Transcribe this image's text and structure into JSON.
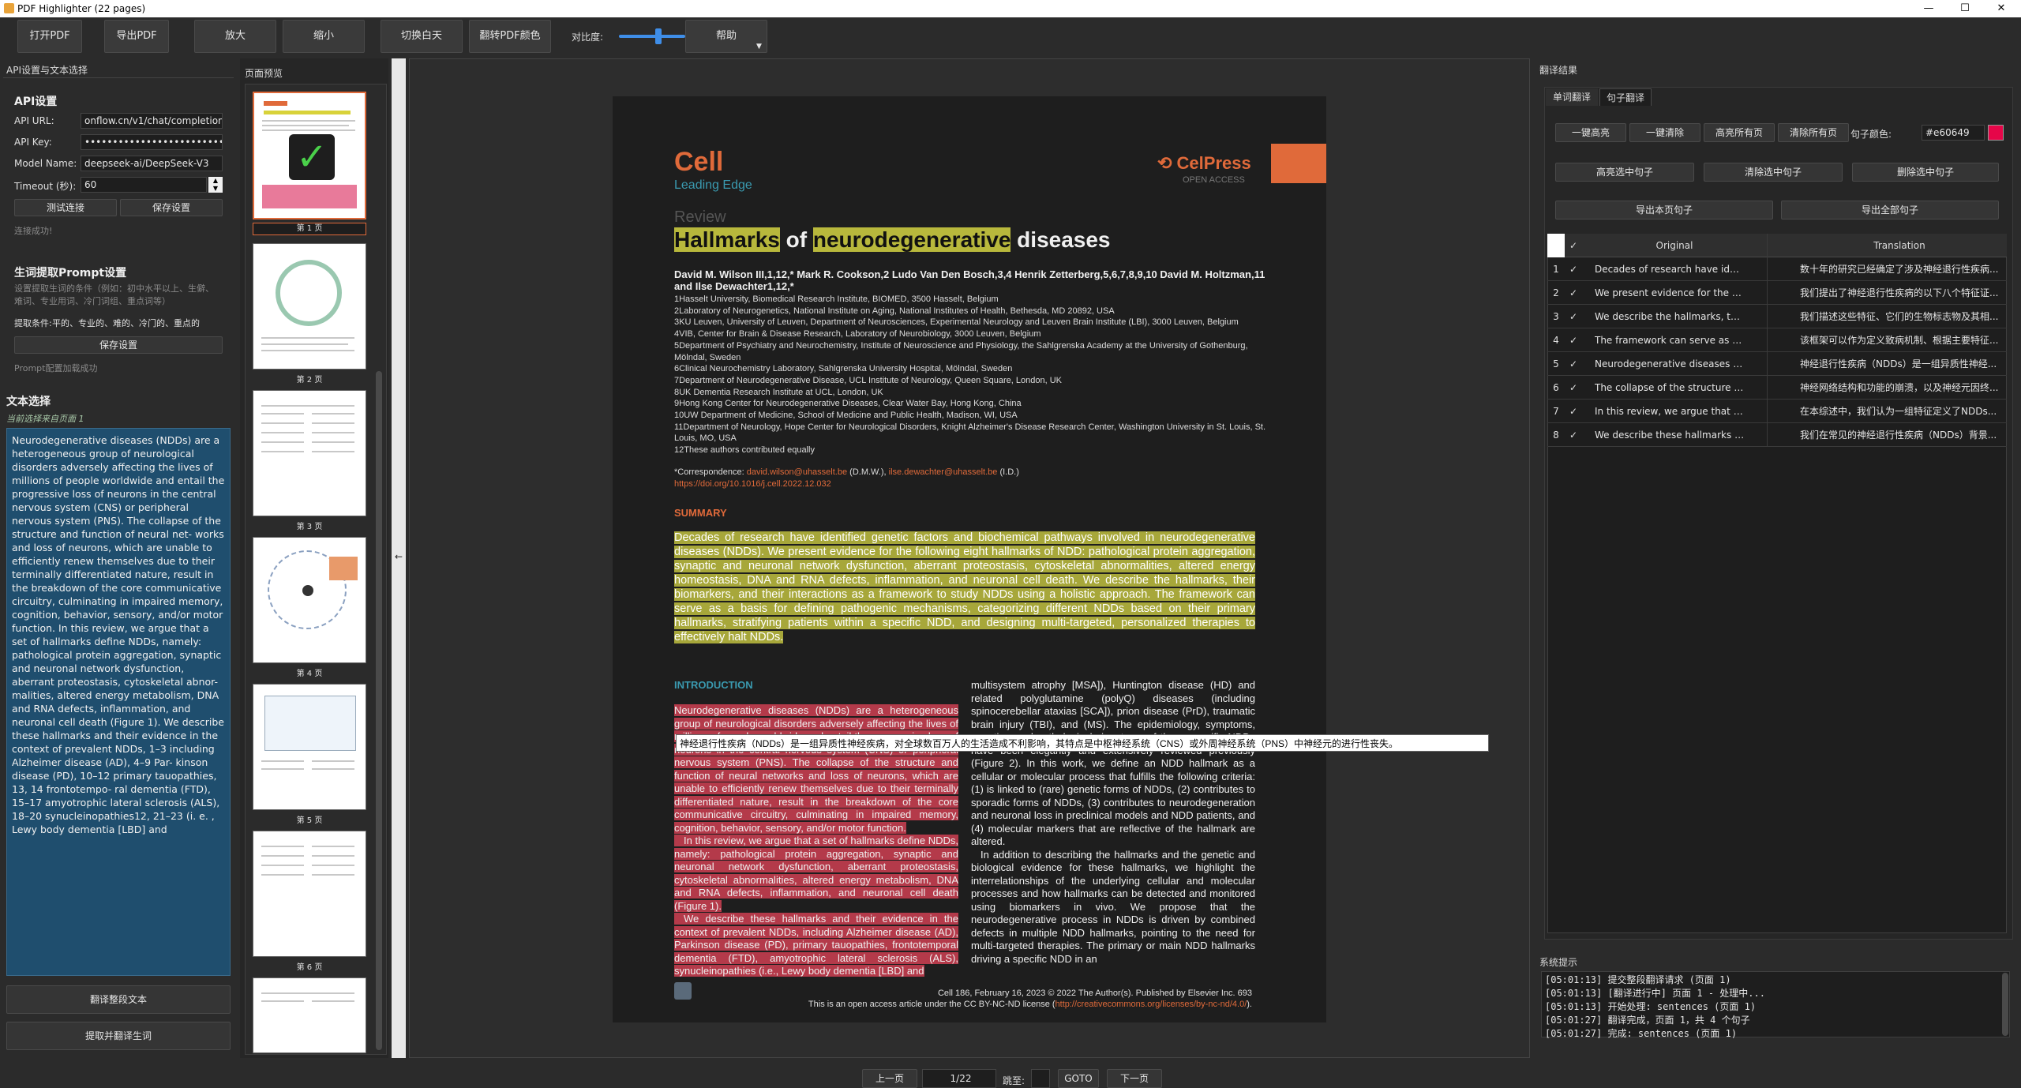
{
  "window": {
    "title": "PDF Highlighter (22 pages)",
    "min": "—",
    "max": "☐",
    "close": "✕"
  },
  "toolbar": {
    "open_pdf": "打开PDF",
    "export_pdf": "导出PDF",
    "zoom_in": "放大",
    "zoom_out": "缩小",
    "toggle_day_night": "切换白天",
    "invert_pdf": "翻转PDF颜色",
    "contrast_label": "对比度:",
    "contrast_value": 0.6,
    "help": "帮助"
  },
  "left": {
    "header": "API设置与文本选择",
    "api_title": "API设置",
    "api_url_label": "API URL:",
    "api_url_value": "onflow.cn/v1/chat/completions",
    "api_key_label": "API Key:",
    "api_key_value": "••••••••••••••••••••••••••••",
    "model_label": "Model Name:",
    "model_value": "deepseek-ai/DeepSeek-V3",
    "timeout_label": "Timeout (秒):",
    "timeout_value": "60",
    "test_btn": "测试连接",
    "save_btn": "保存设置",
    "conn_status": "连接成功!",
    "prompt_title": "生词提取Prompt设置",
    "prompt_desc": "设置提取生词的条件（例如：初中水平以上、生僻、难词、专业用词、冷门词组、重点词等）",
    "prompt_label": "提取条件:",
    "prompt_value": "平的、专业的、难的、冷门的、重点的",
    "prompt_save": "保存设置",
    "prompt_status": "Prompt配置加载成功",
    "text_sel_title": "文本选择",
    "text_sel_sub": "当前选择来自页面 1",
    "selected_text": "Neurodegenerative diseases (NDDs) are a heterogeneous group of neurological disorders adversely affecting the lives of millions of people worldwide and entail the progressive loss of neurons in the central nervous system (CNS) or peripheral nervous system (PNS). The collapse of the structure and function of neural net- works and loss of neurons, which are unable to efficiently renew themselves due to their terminally differentiated nature, result in the breakdown of the core communicative circuitry, culminating in impaired memory, cognition, behavior, sensory, and/or motor function. In this review, we argue that a set of hallmarks define NDDs, namely: pathological protein aggregation, synaptic and neuronal network dysfunction, aberrant proteostasis, cytoskeletal abnor- malities, altered energy metabolism, DNA and RNA defects, inflammation, and neuronal cell death (Figure 1). We describe these hallmarks and their evidence in the context of prevalent NDDs, 1–3 including Alzheimer disease (AD), 4–9 Par- kinson disease (PD), 10–12 primary tauopathies, 13, 14 frontotempo- ral dementia (FTD), 15–17 amyotrophic lateral sclerosis (ALS), 18–20 synucleinopathies12, 21–23 (i. e. , Lewy body dementia [LBD] and",
    "translate_all": "翻译整段文本",
    "extract_btn": "提取并翻译生词"
  },
  "preview": {
    "header": "页面预览",
    "pages": [
      "第 1 页",
      "第 2 页",
      "第 3 页",
      "第 4 页",
      "第 5 页",
      "第 6 页"
    ],
    "collapse_arrow": "←"
  },
  "doc": {
    "journal": "Cell",
    "section": "Leading Edge",
    "publisher": "CelPress",
    "open_access": "OPEN ACCESS",
    "kind": "Review",
    "title_a": "Hallmarks",
    "title_b": " of ",
    "title_c": "neurodegenerative",
    "title_d": " diseases",
    "authors": "David M. Wilson III,1,12,* Mark R. Cookson,2 Ludo Van Den Bosch,3,4 Henrik Zetterberg,5,6,7,8,9,10 David M. Holtzman,11 and Ilse Dewachter1,12,*",
    "affils": [
      "1Hasselt University, Biomedical Research Institute, BIOMED, 3500 Hasselt, Belgium",
      "2Laboratory of Neurogenetics, National Institute on Aging, National Institutes of Health, Bethesda, MD 20892, USA",
      "3KU Leuven, University of Leuven, Department of Neurosciences, Experimental Neurology and Leuven Brain Institute (LBI), 3000 Leuven, Belgium",
      "4VIB, Center for Brain & Disease Research, Laboratory of Neurobiology, 3000 Leuven, Belgium",
      "5Department of Psychiatry and Neurochemistry, Institute of Neuroscience and Physiology, the Sahlgrenska Academy at the University of Gothenburg, Mölndal, Sweden",
      "6Clinical Neurochemistry Laboratory, Sahlgrenska University Hospital, Mölndal, Sweden",
      "7Department of Neurodegenerative Disease, UCL Institute of Neurology, Queen Square, London, UK",
      "8UK Dementia Research Institute at UCL, London, UK",
      "9Hong Kong Center for Neurodegenerative Diseases, Clear Water Bay, Hong Kong, China",
      "10UW Department of Medicine, School of Medicine and Public Health, Madison, WI, USA",
      "11Department of Neurology, Hope Center for Neurological Disorders, Knight Alzheimer's Disease Research Center, Washington University in St. Louis, St. Louis, MO, USA",
      "12These authors contributed equally"
    ],
    "corr_label": "*Correspondence: ",
    "corr_email1": "david.wilson@uhasselt.be",
    "corr_mid": " (D.M.W.), ",
    "corr_email2": "ilse.dewachter@uhasselt.be",
    "corr_end": " (I.D.)",
    "doi": "https://doi.org/10.1016/j.cell.2022.12.032",
    "summary_title": "SUMMARY",
    "summary": "Decades of research have identified genetic factors and biochemical pathways involved in neurodegenerative diseases (NDDs). We present evidence for the following eight hallmarks of NDD: pathological protein aggregation, synaptic and neuronal network dysfunction, aberrant proteostasis, cytoskeletal abnormalities, altered energy homeostasis, DNA and RNA defects, inflammation, and neuronal cell death. We describe the hallmarks, their biomarkers, and their interactions as a framework to study NDDs using a holistic approach. The framework can serve as a basis for defining pathogenic mechanisms, categorizing different NDDs based on their primary hallmarks, stratifying patients within a specific NDD, and designing multi-targeted, personalized therapies to effectively halt NDDs.",
    "intro_title": "INTRODUCTION",
    "intro_left": "Neurodegenerative diseases (NDDs) are a heterogeneous group of neurological disorders adversely affecting the lives of millions of people worldwide and entail the progressive loss of neurons in the central nervous system (CNS) or peripheral nervous system (PNS). The collapse of the structure and function of neural networks and loss of neurons, which are unable to efficiently renew themselves due to their terminally differentiated nature, result in the breakdown of the core communicative circuitry, culminating in impaired memory, cognition, behavior, sensory, and/or motor function.",
    "intro_left2": "In this review, we argue that a set of hallmarks define NDDs, namely: pathological protein aggregation, synaptic and neuronal network dysfunction, aberrant proteostasis, cytoskeletal abnormalities, altered energy metabolism, DNA and RNA defects, inflammation, and neuronal cell death (Figure 1).",
    "intro_left3": "We describe these hallmarks and their evidence in the context of prevalent NDDs, including Alzheimer disease (AD), Parkinson disease (PD), primary tauopathies, frontotemporal dementia (FTD), amyotrophic lateral sclerosis (ALS), synucleinopathies (i.e., Lewy body dementia [LBD] and",
    "intro_right": "multisystem atrophy [MSA]), Huntington disease (HD) and related polyglutamine (polyQ) diseases (including spinocerebellar ataxias [SCA]), prion disease (PrD), traumatic brain injury (TBI), and (MS). The epidemiology, symptoms, genetics, and pathological signatures of these specific NDDs have been elegantly and extensively reviewed previously (Figure 2). In this work, we define an NDD hallmark as a cellular or molecular process that fulfills the following criteria: (1) is linked to (rare) genetic forms of NDDs, (2) contributes to sporadic forms of NDDs, (3) contributes to neurodegeneration and neuronal loss in preclinical models and NDD patients, and (4) molecular markers that are reflective of the hallmark are altered.",
    "intro_right2": "In addition to describing the hallmarks and the genetic and biological evidence for these hallmarks, we highlight the interrelationships of the underlying cellular and molecular processes and how hallmarks can be detected and monitored using biomarkers in vivo. We propose that the neurodegenerative process in NDDs is driven by combined defects in multiple NDD hallmarks, pointing to the need for multi-targeted therapies. The primary or main NDD hallmarks driving a specific NDD in an",
    "tooltip": "神经退行性疾病（NDDs）是一组异质性神经疾病，对全球数百万人的生活造成不利影响，其特点是中枢神经系统（CNS）或外周神经系统（PNS）中神经元的进行性丧失。",
    "footer1": "Cell 186, February 16, 2023 © 2022 The Author(s). Published by Elsevier Inc.   693",
    "footer2a": "This is an open access article under the CC BY-NC-ND license (",
    "footer2b": "http://creativecommons.org/licenses/by-nc-nd/4.0/",
    "footer2c": ")."
  },
  "nav": {
    "prev": "上一页",
    "page": "1/22",
    "jump_label": "跳至:",
    "goto": "GOTO",
    "next": "下一页"
  },
  "right": {
    "header": "翻译结果",
    "tab_word": "单词翻译",
    "tab_sentence": "句子翻译",
    "b_hl_one": "一键高亮",
    "b_clear_one": "一键清除",
    "b_hl_all": "高亮所有页",
    "b_clear_all": "清除所有页",
    "color_label": "句子颜色:",
    "color_value": "#e60649",
    "b_hl_sel": "高亮选中句子",
    "b_clear_sel": "清除选中句子",
    "b_del_sel": "删除选中句子",
    "b_export_page": "导出本页句子",
    "b_export_all": "导出全部句子",
    "col_check": "✓",
    "col_original": "Original",
    "col_translation": "Translation",
    "rows": [
      {
        "n": "1",
        "chk": "✓",
        "orig": "Decades of research have identified ...",
        "trans": "数十年的研究已经确定了涉及神经退行性疾病..."
      },
      {
        "n": "2",
        "chk": "✓",
        "orig": "We present evidence for the following ...",
        "trans": "我们提出了神经退行性疾病的以下八个特征证..."
      },
      {
        "n": "3",
        "chk": "✓",
        "orig": "We describe the hallmarks, their ...",
        "trans": "我们描述这些特征、它们的生物标志物及其相..."
      },
      {
        "n": "4",
        "chk": "✓",
        "orig": "The framework can serve as a basis for ...",
        "trans": "该框架可以作为定义致病机制、根据主要特征..."
      },
      {
        "n": "5",
        "chk": "✓",
        "orig": "Neurodegenerative diseases (NDDs) are ...",
        "trans": "神经退行性疾病（NDDs）是一组异质性神经..."
      },
      {
        "n": "6",
        "chk": "✓",
        "orig": "The collapse of the structure and function...",
        "trans": "神经网络结构和功能的崩溃，以及神经元因终..."
      },
      {
        "n": "7",
        "chk": "✓",
        "orig": "In this review, we argue that a set of ...",
        "trans": "在本综述中，我们认为一组特征定义了NDDs..."
      },
      {
        "n": "8",
        "chk": "✓",
        "orig": "We describe these hallmarks and their ...",
        "trans": "我们在常见的神经退行性疾病（NDDs）背景..."
      }
    ],
    "log_title": "系统提示",
    "logs": [
      "[05:01:13] 提交整段翻译请求 (页面 1)",
      "[05:01:13] [翻译进行中] 页面 1 - 处理中...",
      "[05:01:13] 开始处理: sentences (页面 1)",
      "[05:01:27] 翻译完成，页面 1，共 4 个句子",
      "[05:01:27] 完成: sentences (页面 1)"
    ]
  }
}
